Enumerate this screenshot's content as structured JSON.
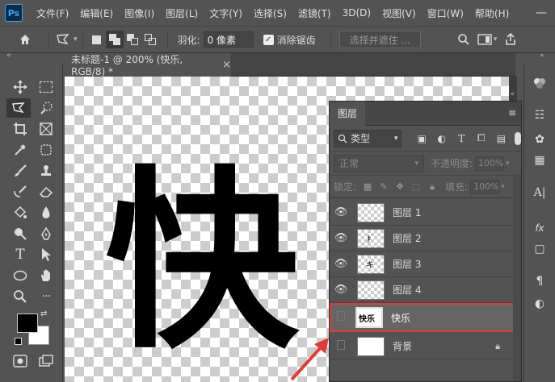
{
  "app": {
    "logo": "Ps"
  },
  "menubar": {
    "items": [
      "文件(F)",
      "编辑(E)",
      "图像(I)",
      "图层(L)",
      "文字(Y)",
      "选择(S)",
      "滤镜(T)",
      "3D(D)",
      "视图(V)",
      "窗口(W)",
      "帮助(H)"
    ],
    "window_controls": [
      "—",
      "☐",
      "✕"
    ]
  },
  "options_bar": {
    "feather_label": "羽化:",
    "feather_value": "0 像素",
    "antialias_label": "消除锯齿",
    "antialias_checked": true,
    "select_mask_label": "选择并遮住 ..."
  },
  "document": {
    "tab_title": "未标题-1 @ 200% (快乐, RGB/8) *",
    "close_glyph": "×",
    "canvas_text": "快"
  },
  "layers_panel": {
    "tab_label": "图层",
    "filter_label": "类型",
    "blend_mode": "正常",
    "opacity_label": "不透明度:",
    "opacity_value": "100%",
    "lock_label": "锁定:",
    "fill_label": "填充:",
    "fill_value": "100%",
    "layers": [
      {
        "name": "图层 1",
        "visible": true,
        "selected": false,
        "thumb_glyph": ""
      },
      {
        "name": "图层 2",
        "visible": true,
        "selected": false,
        "thumb_glyph": "ㅑ"
      },
      {
        "name": "图层 3",
        "visible": true,
        "selected": false,
        "thumb_glyph": "キ"
      },
      {
        "name": "图层 4",
        "visible": true,
        "selected": false,
        "thumb_glyph": ""
      },
      {
        "name": "快乐",
        "visible": false,
        "selected": true,
        "thumb_glyph": "快乐"
      },
      {
        "name": "背景",
        "visible": false,
        "selected": false,
        "thumb_glyph": ""
      }
    ]
  },
  "colors": {
    "ui_bg": "#535353",
    "highlight_box": "#e53935",
    "arrow": "#e53935",
    "selected_row": "#656565",
    "foreground": "#000000",
    "background": "#ffffff"
  }
}
